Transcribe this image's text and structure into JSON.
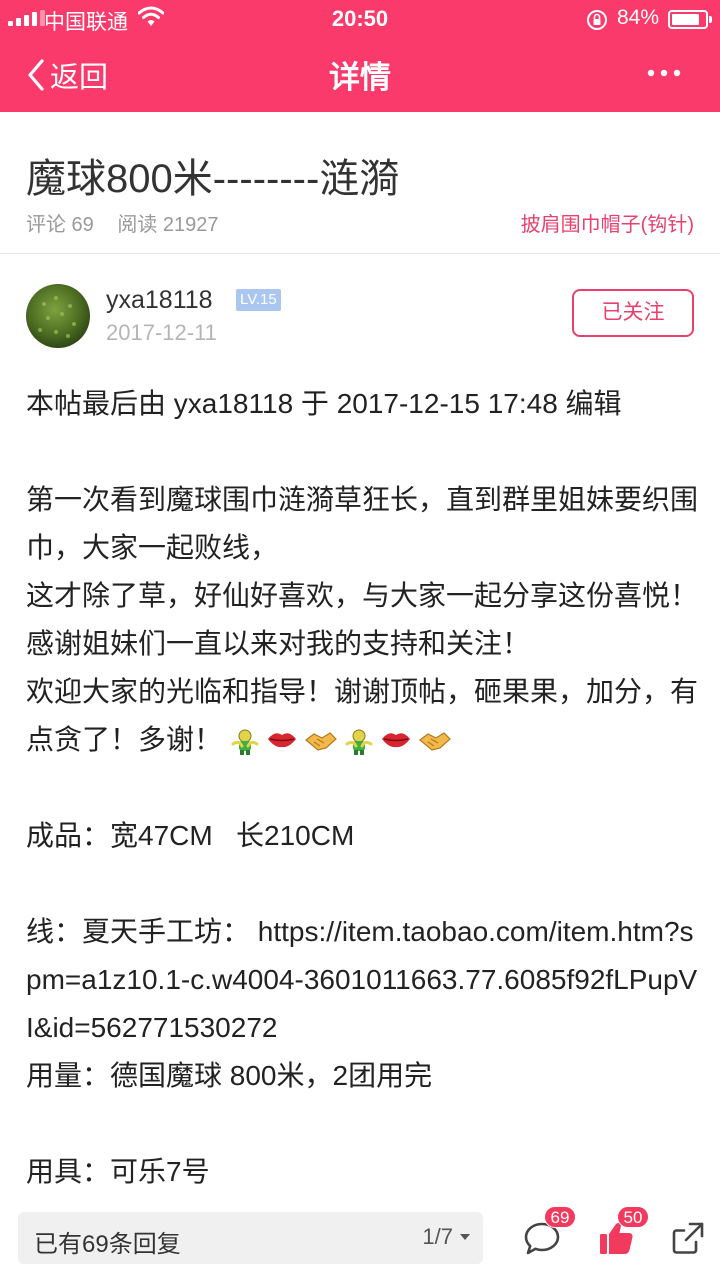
{
  "status": {
    "carrier": "中国联通",
    "time": "20:50",
    "battery": "84%",
    "battery_level": 0.84
  },
  "nav": {
    "back_label": "返回",
    "title": "详情"
  },
  "post": {
    "title": "魔球800米--------涟漪",
    "comments": "评论 69",
    "reads": "阅读 21927",
    "board": "披肩围巾帽子(钩针)"
  },
  "author": {
    "name": "yxa18118",
    "level": "LV.15",
    "date": "2017-12-11",
    "follow_label": "已关注"
  },
  "content": {
    "edit_note": "本帖最后由 yxa18118 于 2017-12-15 17:48 编辑",
    "para1": "第一次看到魔球围巾涟漪草狂长，直到群里姐妹要织围巾，大家一起败线，",
    "para2": "这才除了草，好仙好喜欢，与大家一起分享这份喜悦！",
    "para3": "感谢姐妹们一直以来对我的支持和关注！",
    "para4": "欢迎大家的光临和指导！谢谢顶帖，砸果果，加分，有点贪了！多谢！",
    "emojis": [
      "hugging-figure-icon",
      "lips-icon",
      "handshake-icon",
      "hugging-figure-icon",
      "lips-icon",
      "handshake-icon"
    ],
    "size_line": "成品：宽47CM   长210CM",
    "yarn_line": "线：夏天手工坊： https://item.taobao.com/item.htm?spm=a1z10.1-c.w4004-3601011663.77.6085f92fLPupVI&id=562771530272",
    "usage_line": "用量：德国魔球 800米，2团用完",
    "tool_line": "用具：可乐7号"
  },
  "bottom": {
    "reply_label": "已有69条回复",
    "page": "1/7",
    "comment_count": "69",
    "like_count": "50"
  },
  "colors": {
    "brand": "#fb3a6c",
    "accent": "#e8416e",
    "badge": "#f23a5f"
  }
}
